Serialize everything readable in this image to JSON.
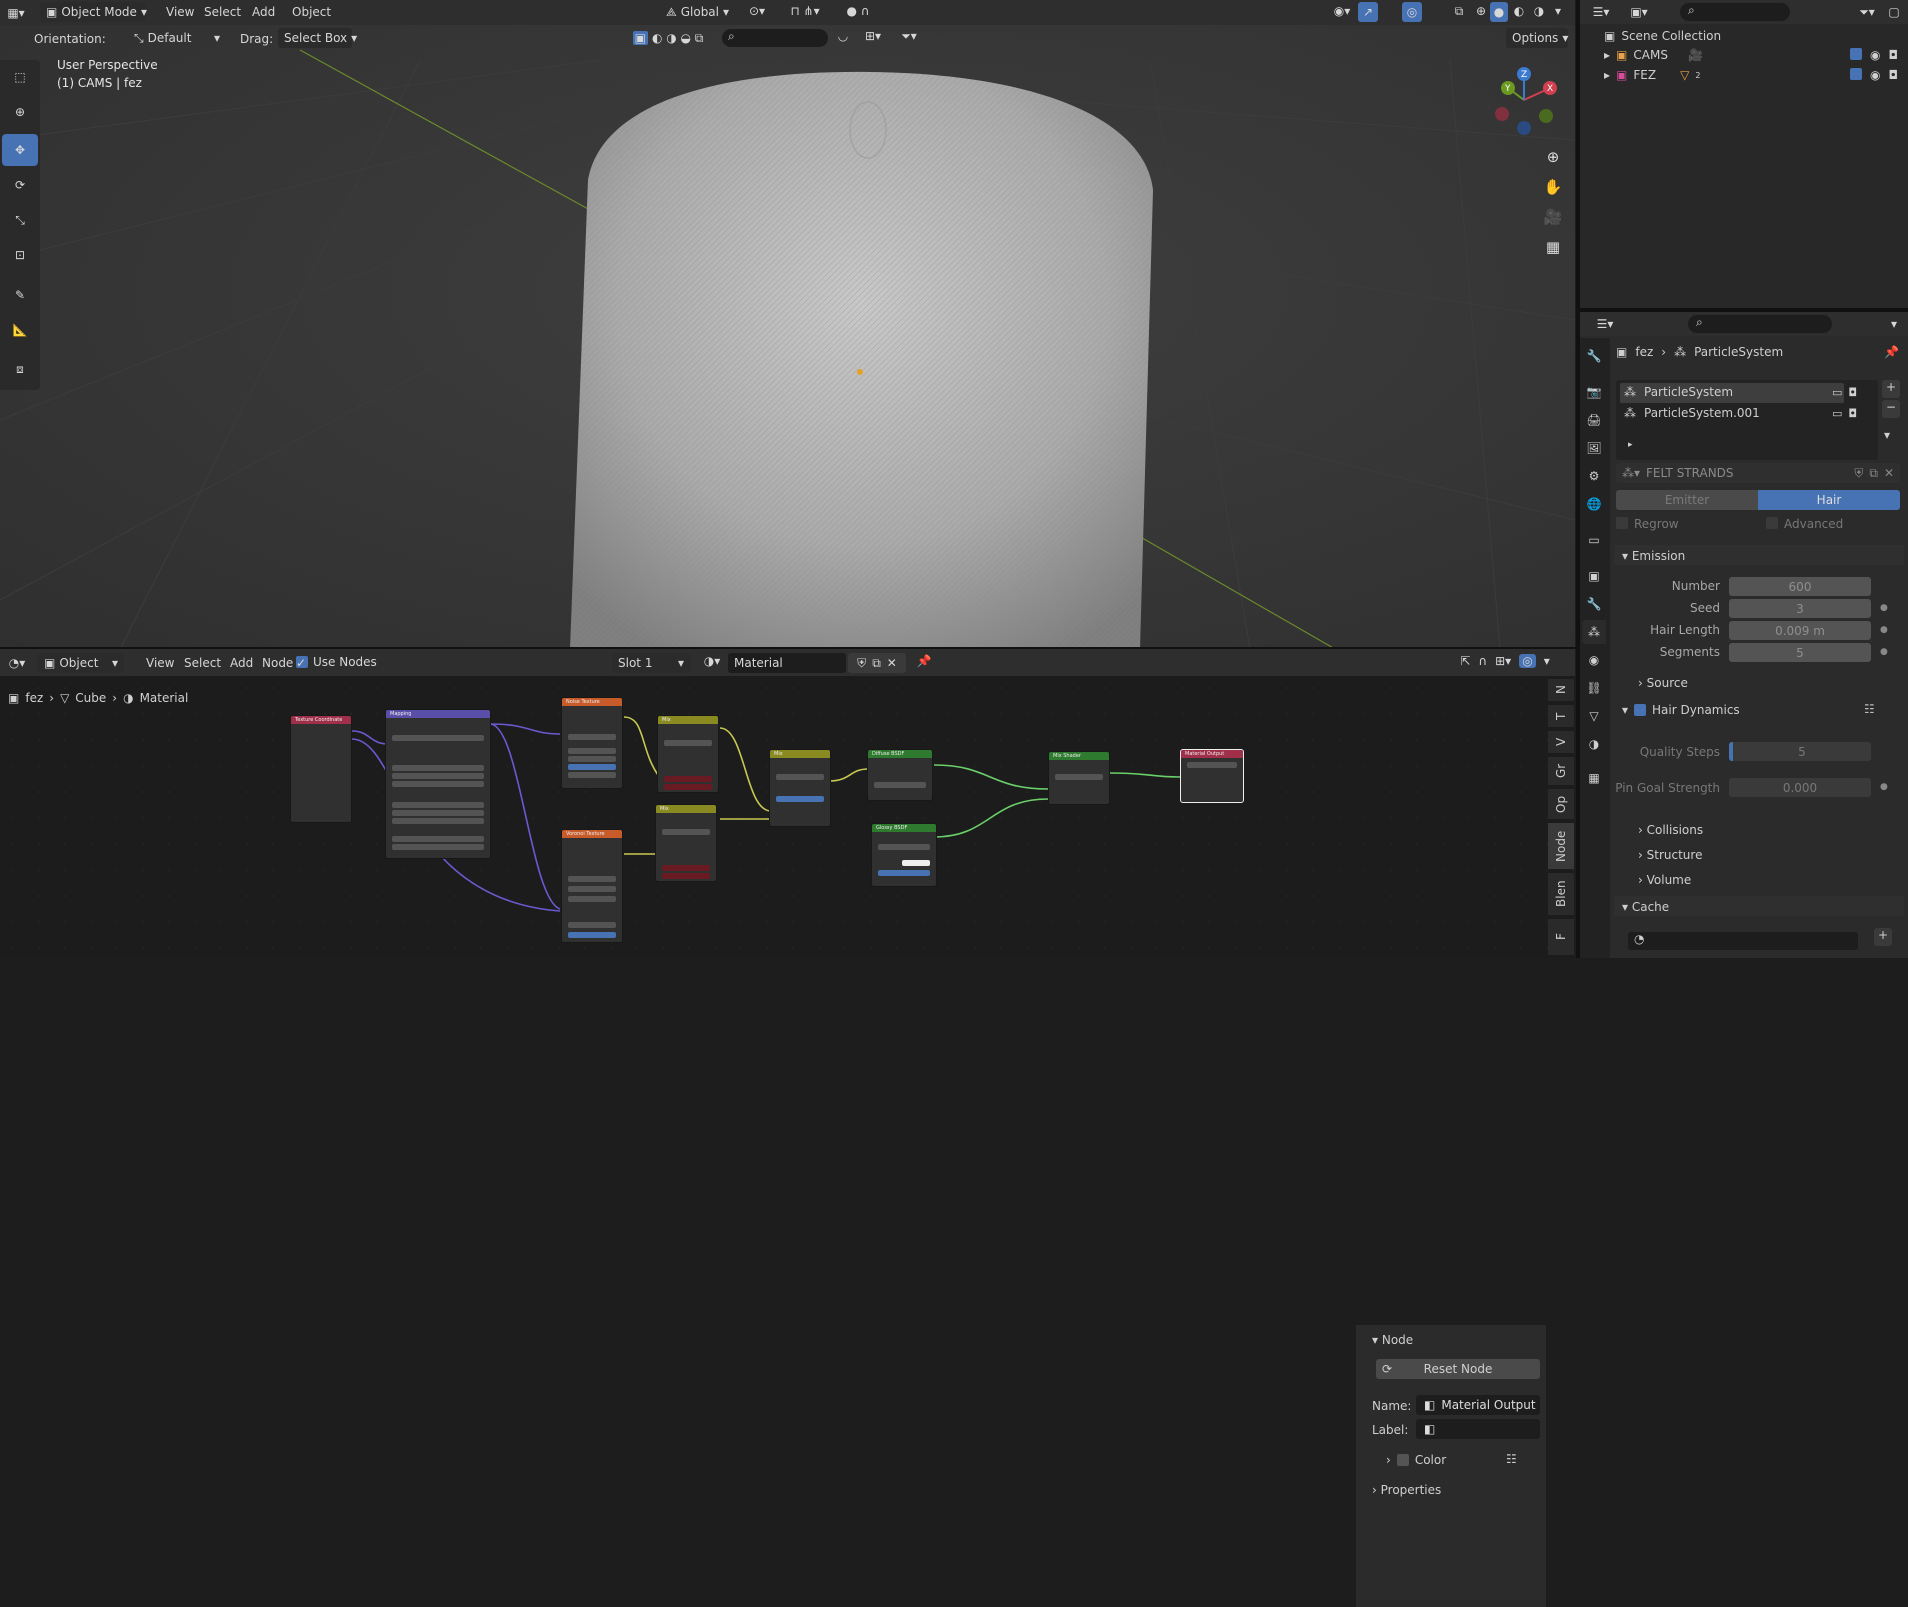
{
  "viewport": {
    "mode": "Object Mode",
    "menus": [
      "View",
      "Select",
      "Add",
      "Object"
    ],
    "transform_orientation": "Global",
    "orientation_label": "Orientation:",
    "orientation_value": "Default",
    "drag_label": "Drag:",
    "drag_value": "Select Box",
    "options": "Options",
    "perspective": "User Perspective",
    "collection_info": "(1) CAMS | fez",
    "gizmo": {
      "x": "X",
      "y": "Y",
      "z": "Z"
    }
  },
  "outliner": {
    "scene_collection": "Scene Collection",
    "items": [
      {
        "name": "CAMS",
        "badge": ""
      },
      {
        "name": "FEZ",
        "badge": "2"
      }
    ]
  },
  "properties": {
    "breadcrumb": {
      "object": "fez",
      "item": "ParticleSystem"
    },
    "particle_systems": [
      "ParticleSystem",
      "ParticleSystem.001"
    ],
    "settings_name": "FELT STRANDS",
    "type_tabs": [
      "Emitter",
      "Hair"
    ],
    "active_type": "Hair",
    "regrow": "Regrow",
    "advanced": "Advanced",
    "emission": {
      "title": "Emission",
      "fields": [
        {
          "label": "Number",
          "value": "600"
        },
        {
          "label": "Seed",
          "value": "3"
        },
        {
          "label": "Hair Length",
          "value": "0.009 m"
        },
        {
          "label": "Segments",
          "value": "5"
        }
      ],
      "source": "Source"
    },
    "hair_dynamics": {
      "title": "Hair Dynamics",
      "quality_label": "Quality Steps",
      "quality_value": "5",
      "pin_label": "Pin Goal Strength",
      "pin_value": "0.000"
    },
    "subpanels": [
      "Collisions",
      "Structure",
      "Volume"
    ],
    "cache": "Cache"
  },
  "node_editor": {
    "type": "Object",
    "menus": [
      "View",
      "Select",
      "Add",
      "Node"
    ],
    "use_nodes": "Use Nodes",
    "slot": "Slot 1",
    "material": "Material",
    "breadcrumb": [
      "fez",
      "Cube",
      "Material"
    ],
    "nodes": [
      {
        "title": "Texture Coordinate",
        "color": "#a0304a"
      },
      {
        "title": "Mapping",
        "color": "#5a4fa8"
      },
      {
        "title": "Noise Texture",
        "color": "#c85b2a"
      },
      {
        "title": "Voronoi Texture",
        "color": "#c85b2a"
      },
      {
        "title": "Mix",
        "color": "#8a8a22"
      },
      {
        "title": "Mix",
        "color": "#8a8a22"
      },
      {
        "title": "Mix",
        "color": "#8a8a22"
      },
      {
        "title": "Diffuse BSDF",
        "color": "#2e7a2e"
      },
      {
        "title": "Glossy BSDF",
        "color": "#2e7a2e"
      },
      {
        "title": "Mix Shader",
        "color": "#2e7a2e"
      },
      {
        "title": "Material Output",
        "color": "#a0304a"
      }
    ],
    "n_panel": {
      "section": "Node",
      "reset": "Reset Node",
      "name_label": "Name:",
      "name_value": "Material Output",
      "label_label": "Label:",
      "label_value": "",
      "color": "Color",
      "properties": "Properties"
    },
    "side_tabs": [
      "N",
      "T",
      "V",
      "Gr",
      "Op",
      "Node",
      "Blen",
      "F"
    ]
  }
}
